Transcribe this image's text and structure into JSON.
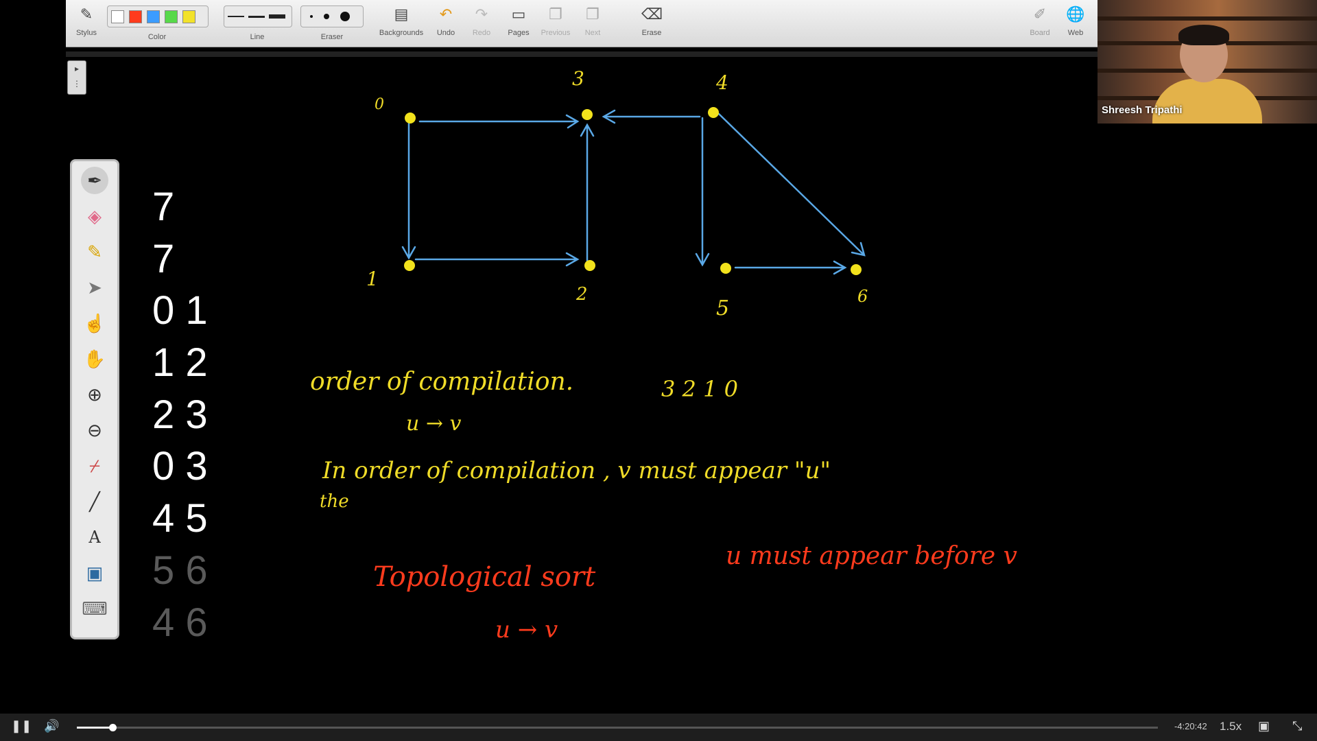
{
  "toolbar": {
    "stylus": "Stylus",
    "color": "Color",
    "line": "Line",
    "eraser": "Eraser",
    "backgrounds": "Backgrounds",
    "undo": "Undo",
    "redo": "Redo",
    "pages": "Pages",
    "previous": "Previous",
    "next": "Next",
    "erase": "Erase",
    "board": "Board",
    "web": "Web",
    "swatches": [
      "#ffffff",
      "#ff3b1d",
      "#3b9cff",
      "#57d94a",
      "#f2e22a"
    ]
  },
  "webcam": {
    "name": "Shreesh Tripathi"
  },
  "input_list": {
    "rows": [
      "7",
      "7",
      "0 1",
      "1 2",
      "2 3",
      "0 3",
      "4 5",
      "5 6",
      "4 6"
    ]
  },
  "graph": {
    "node_labels": [
      "0",
      "3",
      "4",
      "1",
      "2",
      "5",
      "6"
    ],
    "node_color": "#f2e21c",
    "edge_color": "#5aa8e6"
  },
  "notes": {
    "order_of_compilation": "order of compilation.",
    "sequence": "3  2  1  0",
    "u_to_v": "u → v",
    "in_order_line": "In order of compilation , v must appear \"u\"",
    "the": "the",
    "topological_sort": "Topological sort",
    "u_must_appear": "u must appear before v",
    "u_to_v_red": "u → v"
  },
  "player": {
    "time_remaining": "-4:20:42",
    "speed": "1.5x",
    "progress": 0.033
  }
}
